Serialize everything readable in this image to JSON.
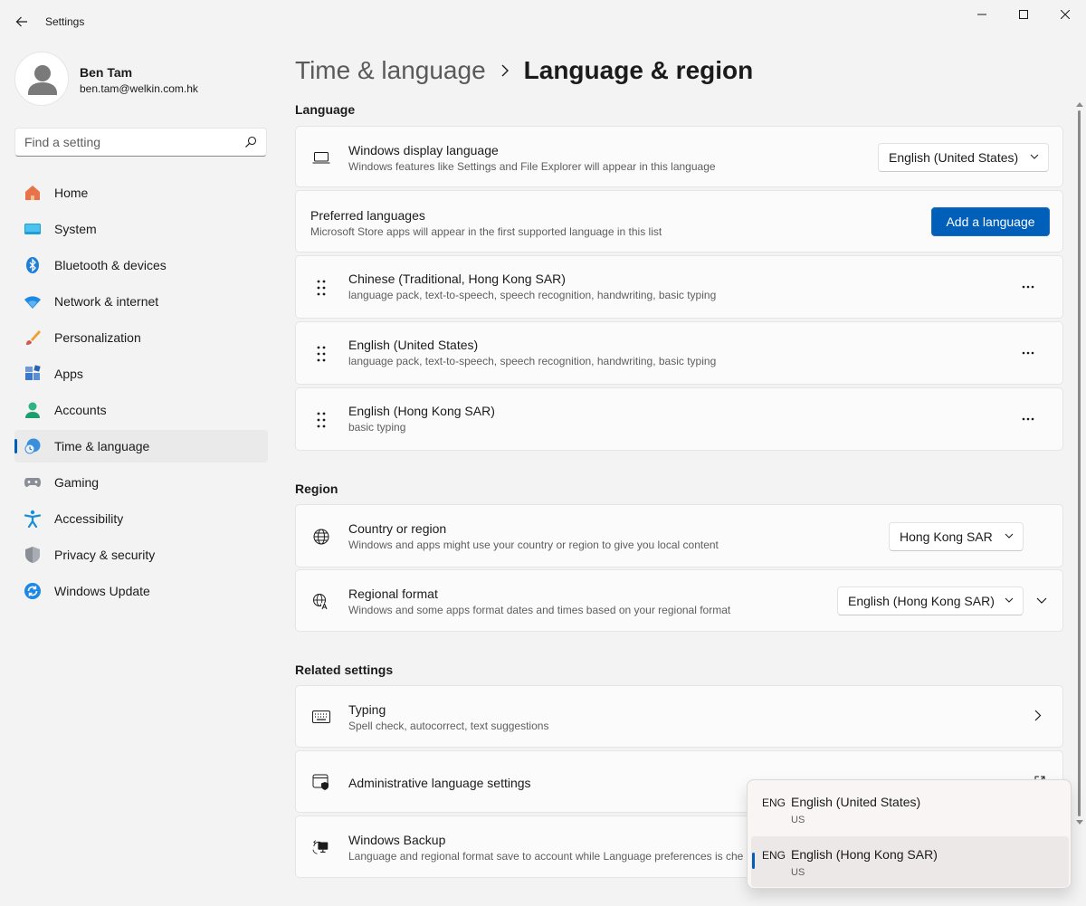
{
  "window": {
    "title": "Settings"
  },
  "profile": {
    "name": "Ben Tam",
    "email": "ben.tam@welkin.com.hk"
  },
  "search": {
    "placeholder": "Find a setting"
  },
  "sidebar": {
    "items": [
      {
        "label": "Home",
        "icon": "home-icon"
      },
      {
        "label": "System",
        "icon": "system-icon"
      },
      {
        "label": "Bluetooth & devices",
        "icon": "bluetooth-icon"
      },
      {
        "label": "Network & internet",
        "icon": "wifi-icon"
      },
      {
        "label": "Personalization",
        "icon": "brush-icon"
      },
      {
        "label": "Apps",
        "icon": "apps-icon"
      },
      {
        "label": "Accounts",
        "icon": "accounts-icon"
      },
      {
        "label": "Time & language",
        "icon": "time-language-icon",
        "active": true
      },
      {
        "label": "Gaming",
        "icon": "gamepad-icon"
      },
      {
        "label": "Accessibility",
        "icon": "accessibility-icon"
      },
      {
        "label": "Privacy & security",
        "icon": "shield-icon"
      },
      {
        "label": "Windows Update",
        "icon": "update-icon"
      }
    ]
  },
  "breadcrumb": {
    "parent": "Time & language",
    "current": "Language & region"
  },
  "language": {
    "section_title": "Language",
    "display": {
      "title": "Windows display language",
      "subtitle": "Windows features like Settings and File Explorer will appear in this language",
      "value": "English (United States)"
    },
    "preferred": {
      "title": "Preferred languages",
      "subtitle": "Microsoft Store apps will appear in the first supported language in this list",
      "button": "Add a language"
    },
    "list": [
      {
        "title": "Chinese (Traditional, Hong Kong SAR)",
        "subtitle": "language pack, text-to-speech, speech recognition, handwriting, basic typing"
      },
      {
        "title": "English (United States)",
        "subtitle": "language pack, text-to-speech, speech recognition, handwriting, basic typing"
      },
      {
        "title": "English (Hong Kong SAR)",
        "subtitle": "basic typing"
      }
    ]
  },
  "region": {
    "section_title": "Region",
    "country": {
      "title": "Country or region",
      "subtitle": "Windows and apps might use your country or region to give you local content",
      "value": "Hong Kong SAR"
    },
    "format": {
      "title": "Regional format",
      "subtitle": "Windows and some apps format dates and times based on your regional format",
      "value": "English (Hong Kong SAR)"
    }
  },
  "related": {
    "section_title": "Related settings",
    "typing": {
      "title": "Typing",
      "subtitle": "Spell check, autocorrect, text suggestions"
    },
    "admin": {
      "title": "Administrative language settings"
    },
    "backup": {
      "title": "Windows Backup",
      "subtitle": "Language and regional format save to account while Language preferences is che"
    }
  },
  "flyout": {
    "items": [
      {
        "code": "ENG",
        "name": "English (United States)",
        "sub": "US"
      },
      {
        "code": "ENG",
        "name": "English (Hong Kong SAR)",
        "sub": "US",
        "selected": true
      }
    ]
  },
  "colors": {
    "accent": "#005fb8",
    "background": "#f3f3f3",
    "card": "#fbfbfb"
  }
}
